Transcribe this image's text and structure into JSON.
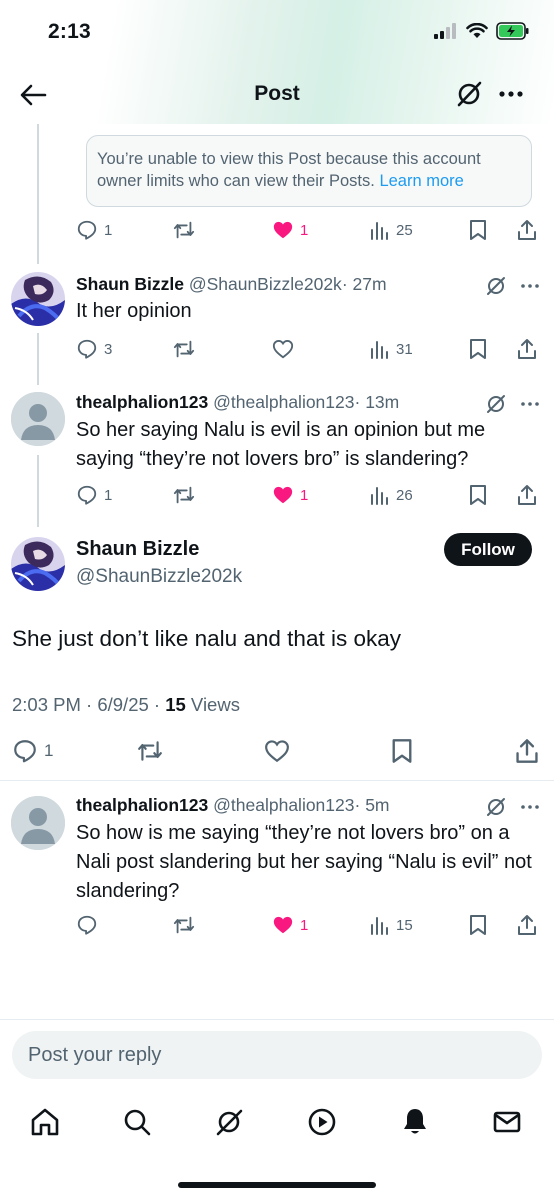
{
  "status_bar": {
    "time": "2:13"
  },
  "header": {
    "title": "Post"
  },
  "restricted_notice": {
    "text": "You’re unable to view this Post because this account owner limits who can view their Posts.",
    "link": "Learn more"
  },
  "restricted_actions": {
    "replies": "1",
    "likes": "1",
    "views": "25"
  },
  "reply1": {
    "display_name": "Shaun Bizzle",
    "handle": "@ShaunBizzle202k",
    "time": "· 27m",
    "text": "It her opinion",
    "replies": "3",
    "views": "31"
  },
  "reply2": {
    "display_name": "thealphalion123",
    "handle": "@thealphalion123",
    "time": "· 13m",
    "text": "So her saying Nalu is evil is an opinion but me saying “they’re not lovers bro” is slandering?",
    "replies": "1",
    "likes": "1",
    "views": "26"
  },
  "main_post": {
    "display_name": "Shaun Bizzle",
    "handle": "@ShaunBizzle202k",
    "follow_label": "Follow",
    "text": "She just don’t like nalu and that is okay",
    "timestamp": "2:03 PM · 6/9/25 · ",
    "views_count": "15",
    "views_label": " Views",
    "replies": "1"
  },
  "reply3": {
    "display_name": "thealphalion123",
    "handle": "@thealphalion123",
    "time": "· 5m",
    "text": "So how is me saying “they’re not lovers bro” on a Nali post slandering but her saying “Nalu is evil” not slandering?",
    "likes": "1",
    "views": "15"
  },
  "reply_box": {
    "placeholder": "Post your reply"
  },
  "tab_bar": [
    "home-icon",
    "search-icon",
    "grok-icon",
    "video-icon",
    "notifications-icon",
    "messages-icon"
  ],
  "colors": {
    "accent": "#1d9bf0",
    "like": "#f91880",
    "text": "#0f1419",
    "secondary": "#536471"
  }
}
